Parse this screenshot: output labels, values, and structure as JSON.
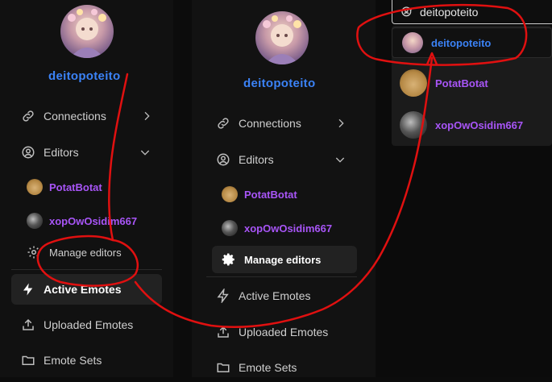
{
  "user": {
    "name": "deitopoteito"
  },
  "nav": {
    "connections": "Connections",
    "editors": "Editors",
    "manage_editors": "Manage editors",
    "active_emotes": "Active Emotes",
    "uploaded_emotes": "Uploaded Emotes",
    "emote_sets": "Emote Sets"
  },
  "editors": [
    {
      "name": "PotatBotat"
    },
    {
      "name": "xopOwOsidim667"
    }
  ],
  "search": {
    "value": "deitopoteito"
  },
  "results": [
    {
      "name": "deitopoteito"
    },
    {
      "name": "PotatBotat"
    },
    {
      "name": "xopOwOsidim667"
    }
  ],
  "colors": {
    "username": "#3b82f6",
    "editor_name": "#a855f7",
    "annotation": "#e01010"
  },
  "icons": {
    "connections": "link-icon",
    "editors": "user-circle-icon",
    "manage_editors": "gear-icon",
    "active_emotes": "lightning-icon",
    "uploaded_emotes": "upload-icon",
    "emote_sets": "folder-icon",
    "search": "user-search-icon"
  }
}
